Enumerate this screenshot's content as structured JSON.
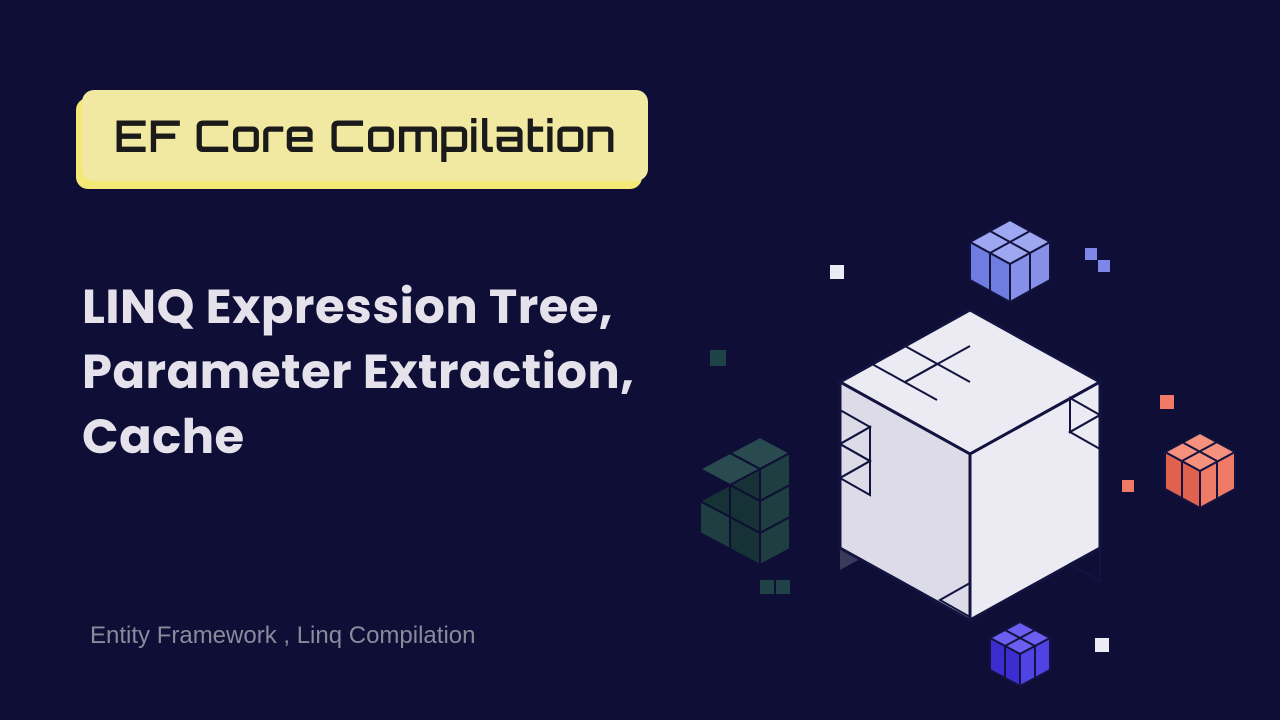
{
  "title": "EF Core Compilation",
  "subtitle": "LINQ Expression Tree, Parameter Extraction, Cache",
  "footer": "Entity Framework , Linq Compilation",
  "colors": {
    "background": "#0e0e36",
    "badge_bg": "#f1e9a1",
    "badge_shadow": "#f4e876",
    "cube_main": "#eceaf3",
    "cube_blue": "#7c87e8",
    "cube_indigo": "#4a3be0",
    "cube_orange": "#f07a66",
    "cube_teal": "#1f4246",
    "accent_white": "#ffffff",
    "accent_orange": "#f07a66"
  }
}
